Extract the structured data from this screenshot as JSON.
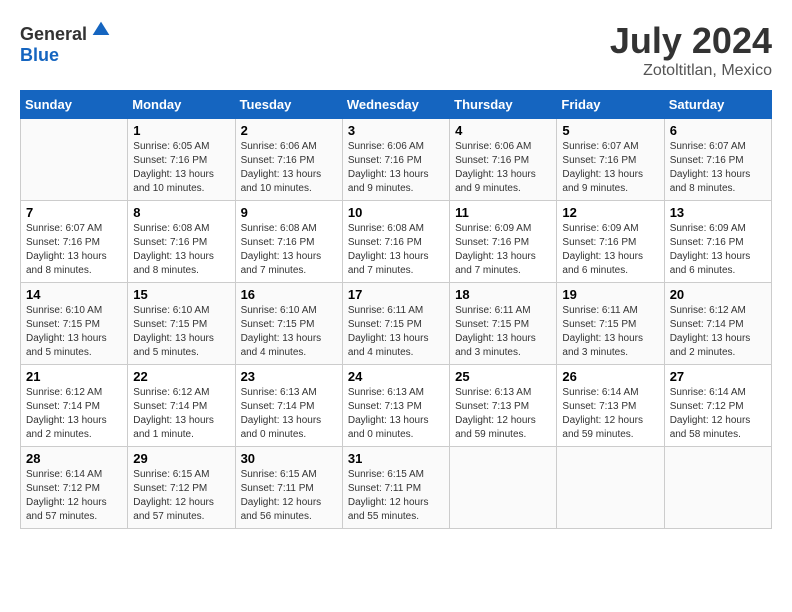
{
  "logo": {
    "general": "General",
    "blue": "Blue"
  },
  "title": "July 2024",
  "subtitle": "Zotoltitlan, Mexico",
  "days_of_week": [
    "Sunday",
    "Monday",
    "Tuesday",
    "Wednesday",
    "Thursday",
    "Friday",
    "Saturday"
  ],
  "weeks": [
    [
      {
        "day": "",
        "info": ""
      },
      {
        "day": "1",
        "info": "Sunrise: 6:05 AM\nSunset: 7:16 PM\nDaylight: 13 hours\nand 10 minutes."
      },
      {
        "day": "2",
        "info": "Sunrise: 6:06 AM\nSunset: 7:16 PM\nDaylight: 13 hours\nand 10 minutes."
      },
      {
        "day": "3",
        "info": "Sunrise: 6:06 AM\nSunset: 7:16 PM\nDaylight: 13 hours\nand 9 minutes."
      },
      {
        "day": "4",
        "info": "Sunrise: 6:06 AM\nSunset: 7:16 PM\nDaylight: 13 hours\nand 9 minutes."
      },
      {
        "day": "5",
        "info": "Sunrise: 6:07 AM\nSunset: 7:16 PM\nDaylight: 13 hours\nand 9 minutes."
      },
      {
        "day": "6",
        "info": "Sunrise: 6:07 AM\nSunset: 7:16 PM\nDaylight: 13 hours\nand 8 minutes."
      }
    ],
    [
      {
        "day": "7",
        "info": "Sunrise: 6:07 AM\nSunset: 7:16 PM\nDaylight: 13 hours\nand 8 minutes."
      },
      {
        "day": "8",
        "info": "Sunrise: 6:08 AM\nSunset: 7:16 PM\nDaylight: 13 hours\nand 8 minutes."
      },
      {
        "day": "9",
        "info": "Sunrise: 6:08 AM\nSunset: 7:16 PM\nDaylight: 13 hours\nand 7 minutes."
      },
      {
        "day": "10",
        "info": "Sunrise: 6:08 AM\nSunset: 7:16 PM\nDaylight: 13 hours\nand 7 minutes."
      },
      {
        "day": "11",
        "info": "Sunrise: 6:09 AM\nSunset: 7:16 PM\nDaylight: 13 hours\nand 7 minutes."
      },
      {
        "day": "12",
        "info": "Sunrise: 6:09 AM\nSunset: 7:16 PM\nDaylight: 13 hours\nand 6 minutes."
      },
      {
        "day": "13",
        "info": "Sunrise: 6:09 AM\nSunset: 7:16 PM\nDaylight: 13 hours\nand 6 minutes."
      }
    ],
    [
      {
        "day": "14",
        "info": "Sunrise: 6:10 AM\nSunset: 7:15 PM\nDaylight: 13 hours\nand 5 minutes."
      },
      {
        "day": "15",
        "info": "Sunrise: 6:10 AM\nSunset: 7:15 PM\nDaylight: 13 hours\nand 5 minutes."
      },
      {
        "day": "16",
        "info": "Sunrise: 6:10 AM\nSunset: 7:15 PM\nDaylight: 13 hours\nand 4 minutes."
      },
      {
        "day": "17",
        "info": "Sunrise: 6:11 AM\nSunset: 7:15 PM\nDaylight: 13 hours\nand 4 minutes."
      },
      {
        "day": "18",
        "info": "Sunrise: 6:11 AM\nSunset: 7:15 PM\nDaylight: 13 hours\nand 3 minutes."
      },
      {
        "day": "19",
        "info": "Sunrise: 6:11 AM\nSunset: 7:15 PM\nDaylight: 13 hours\nand 3 minutes."
      },
      {
        "day": "20",
        "info": "Sunrise: 6:12 AM\nSunset: 7:14 PM\nDaylight: 13 hours\nand 2 minutes."
      }
    ],
    [
      {
        "day": "21",
        "info": "Sunrise: 6:12 AM\nSunset: 7:14 PM\nDaylight: 13 hours\nand 2 minutes."
      },
      {
        "day": "22",
        "info": "Sunrise: 6:12 AM\nSunset: 7:14 PM\nDaylight: 13 hours\nand 1 minute."
      },
      {
        "day": "23",
        "info": "Sunrise: 6:13 AM\nSunset: 7:14 PM\nDaylight: 13 hours\nand 0 minutes."
      },
      {
        "day": "24",
        "info": "Sunrise: 6:13 AM\nSunset: 7:13 PM\nDaylight: 13 hours\nand 0 minutes."
      },
      {
        "day": "25",
        "info": "Sunrise: 6:13 AM\nSunset: 7:13 PM\nDaylight: 12 hours\nand 59 minutes."
      },
      {
        "day": "26",
        "info": "Sunrise: 6:14 AM\nSunset: 7:13 PM\nDaylight: 12 hours\nand 59 minutes."
      },
      {
        "day": "27",
        "info": "Sunrise: 6:14 AM\nSunset: 7:12 PM\nDaylight: 12 hours\nand 58 minutes."
      }
    ],
    [
      {
        "day": "28",
        "info": "Sunrise: 6:14 AM\nSunset: 7:12 PM\nDaylight: 12 hours\nand 57 minutes."
      },
      {
        "day": "29",
        "info": "Sunrise: 6:15 AM\nSunset: 7:12 PM\nDaylight: 12 hours\nand 57 minutes."
      },
      {
        "day": "30",
        "info": "Sunrise: 6:15 AM\nSunset: 7:11 PM\nDaylight: 12 hours\nand 56 minutes."
      },
      {
        "day": "31",
        "info": "Sunrise: 6:15 AM\nSunset: 7:11 PM\nDaylight: 12 hours\nand 55 minutes."
      },
      {
        "day": "",
        "info": ""
      },
      {
        "day": "",
        "info": ""
      },
      {
        "day": "",
        "info": ""
      }
    ]
  ]
}
